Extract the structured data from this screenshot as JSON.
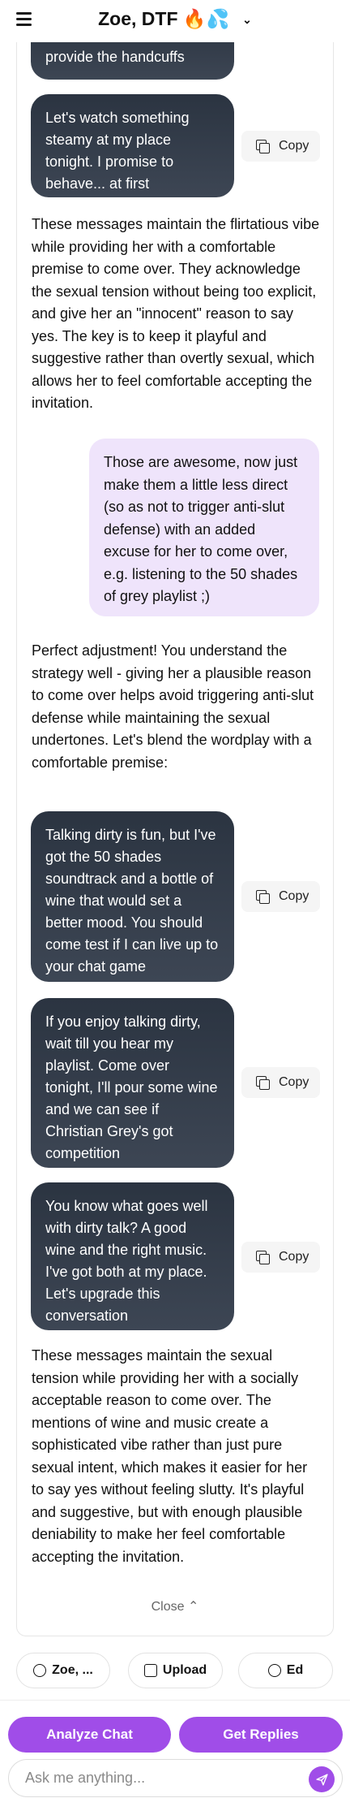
{
  "header": {
    "title": "Zoe, DTF 🔥💦",
    "chevron": "⌄"
  },
  "conversation": {
    "messages_top": [
      {
        "text": "...bring some wine, I'll provide the handcuffs",
        "visible_text": "provide the handcuffs"
      },
      {
        "text": "Let's watch something steamy at my place tonight. I promise to behave... at first"
      }
    ],
    "reply_1": "These messages maintain the flirtatious vibe while providing her with a comfortable premise to come over. They acknowledge the sexual tension without being too explicit, and give her an \"innocent\" reason to say yes. The key is to keep it playful and suggestive rather than overtly sexual, which allows her to feel comfortable accepting the invitation.",
    "user_message": "Those are awesome, now just make them a little less direct (so as not to trigger anti-slut defense) with an added excuse for her to come over, e.g. listening to the 50 shades of grey playlist ;)",
    "reply_2": "Perfect adjustment! You understand the strategy well - giving her a plausible reason to come over helps avoid triggering anti-slut defense while maintaining the sexual undertones. Let's blend the wordplay with a comfortable premise:",
    "suggestions": [
      {
        "text": "Talking dirty is fun, but I've got the 50 shades soundtrack and a bottle of wine that would set a better mood. You should come test if I can live up to your chat game"
      },
      {
        "text": "If you enjoy talking dirty, wait till you hear my playlist. Come over tonight, I'll pour some wine and we can see if Christian Grey's got competition"
      },
      {
        "text": "You know what goes well with dirty talk? A good wine and the right music. I've got both at my place. Let's upgrade this conversation"
      }
    ],
    "reply_3": "These messages maintain the sexual tension while providing her with a socially acceptable reason to come over. The mentions of wine and music create a sophisticated vibe rather than just pure sexual intent, which makes it easier for her to say yes without feeling slutty. It's playful and suggestive, but with enough plausible deniability to make her feel comfortable accepting the invitation.",
    "copy_label": "Copy",
    "close_label": "Close ⌃"
  },
  "chips": {
    "contact": "Zoe, ...",
    "upload": "Upload",
    "ed": "Ed"
  },
  "actions": {
    "analyze": "Analyze Chat",
    "replies": "Get Replies"
  },
  "input": {
    "placeholder": "Ask me anything..."
  },
  "colors": {
    "accent": "#a04de8",
    "user_bubble": "#efe4fb",
    "dark_bubble": "#2b3441"
  }
}
